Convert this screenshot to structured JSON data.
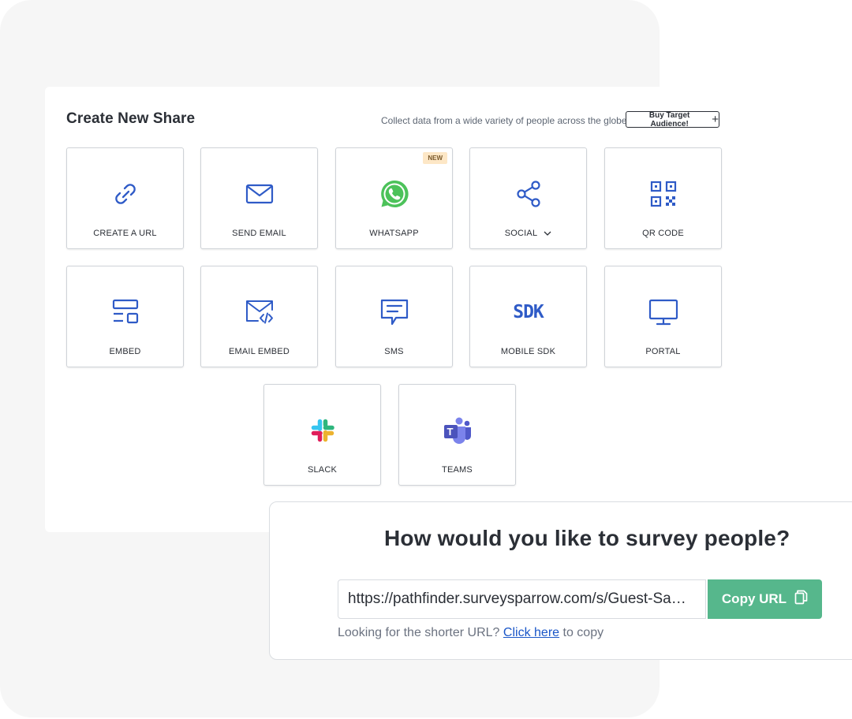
{
  "share": {
    "title": "Create New Share",
    "subtitle": "Collect data from a wide variety of people across the globe",
    "buy_button_label": "Buy Target Audience!",
    "buy_button_icon": "plus-icon",
    "tiles": [
      {
        "label": "CREATE A URL",
        "icon": "link-icon"
      },
      {
        "label": "SEND EMAIL",
        "icon": "envelope-icon"
      },
      {
        "label": "WHATSAPP",
        "icon": "whatsapp-icon",
        "badge": "NEW"
      },
      {
        "label": "SOCIAL",
        "icon": "share-icon",
        "has_dropdown": true
      },
      {
        "label": "QR CODE",
        "icon": "qr-code-icon"
      },
      {
        "label": "EMBED",
        "icon": "embed-icon"
      },
      {
        "label": "EMAIL EMBED",
        "icon": "email-embed-icon"
      },
      {
        "label": "SMS",
        "icon": "sms-icon"
      },
      {
        "label": "MOBILE SDK",
        "icon": "sdk-icon",
        "icon_text": "SDK"
      },
      {
        "label": "PORTAL",
        "icon": "monitor-icon"
      },
      {
        "label": "SLACK",
        "icon": "slack-icon"
      },
      {
        "label": "TEAMS",
        "icon": "teams-icon",
        "icon_text": "T"
      }
    ]
  },
  "survey": {
    "heading": "How would you like to survey people?",
    "url_value": "https://pathfinder.surveysparrow.com/s/Guest-Sa…",
    "copy_button_label": "Copy URL",
    "copy_icon": "copy-icon",
    "hint_prefix": "Looking for the shorter URL?",
    "hint_link": "Click here",
    "hint_suffix": "to copy"
  },
  "colors": {
    "accent_blue": "#2f5bc7",
    "whatsapp_green": "#4cc25a",
    "copy_green": "#56b78c",
    "link_blue": "#1a56c8",
    "badge_bg": "#fde7c6",
    "teams_purple": "#5b5fc7"
  }
}
